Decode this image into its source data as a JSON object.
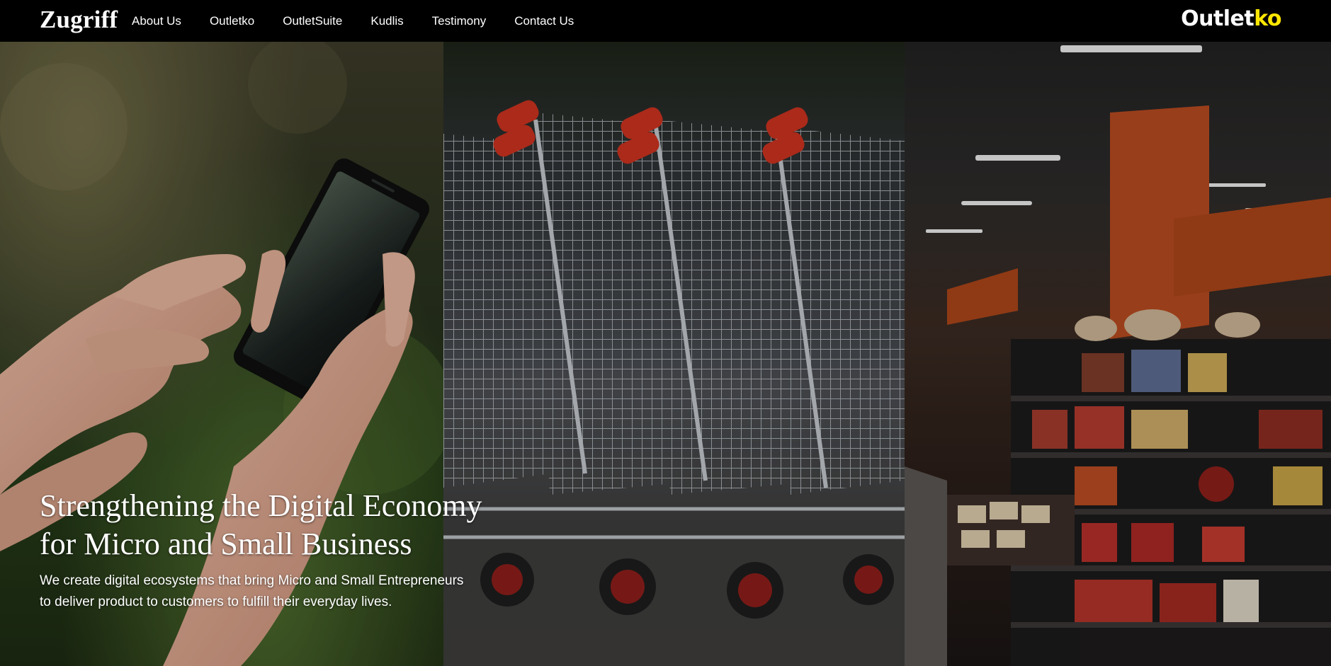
{
  "nav": {
    "brand": "Zugriff",
    "links": [
      {
        "label": "About Us"
      },
      {
        "label": "Outletko"
      },
      {
        "label": "OutletSuite"
      },
      {
        "label": "Kudlis"
      },
      {
        "label": "Testimony"
      },
      {
        "label": "Contact Us"
      }
    ],
    "partner_logo": {
      "part1": "Outlet",
      "part2": "ko",
      "accent_color": "#ffe600"
    }
  },
  "hero": {
    "title_line1": "Strengthening the Digital Economy",
    "title_line2": "for Micro and Small Business",
    "subtitle_line1": "We create digital ecosystems that bring Micro and Small Entrepreneurs",
    "subtitle_line2": "to deliver product to customers to fulfill their everyday lives."
  },
  "colors": {
    "background": "#000000",
    "text": "#ffffff",
    "accent": "#ffe600"
  }
}
